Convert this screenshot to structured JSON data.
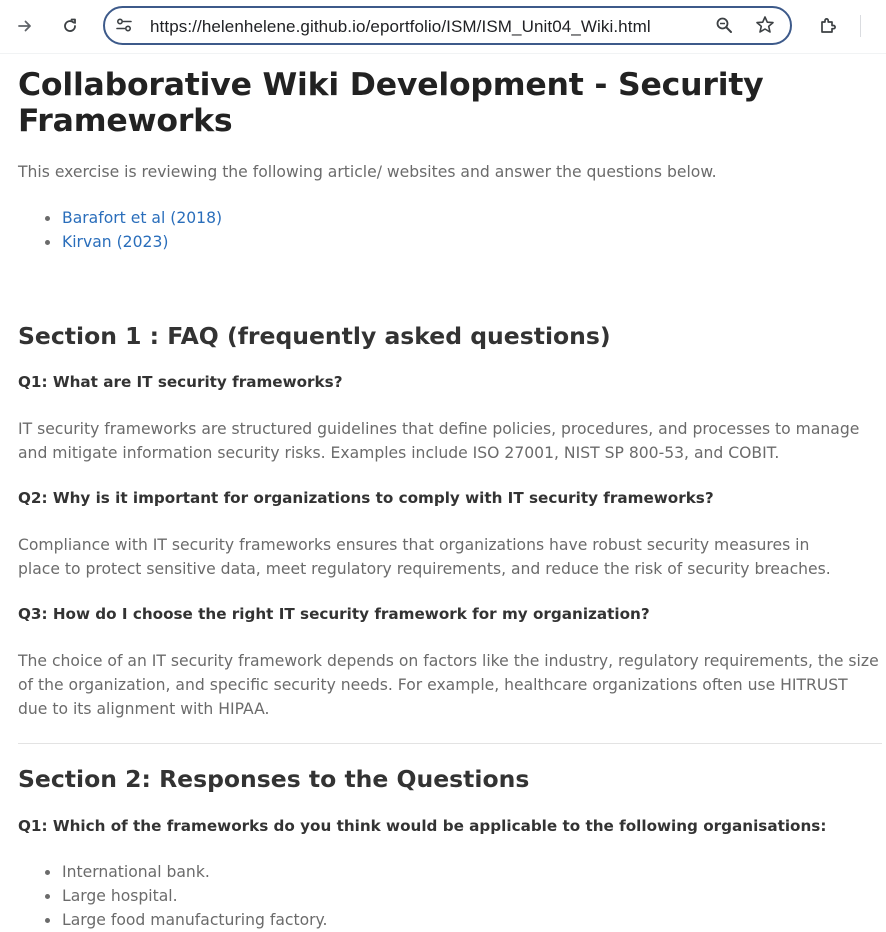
{
  "browser": {
    "url": "https://helenhelene.github.io/eportfolio/ISM/ISM_Unit04_Wiki.html",
    "icons": [
      "forward-arrow-icon",
      "reload-icon",
      "site-settings-icon",
      "zoom-icon",
      "bookmark-star-icon",
      "extensions-icon"
    ]
  },
  "page": {
    "title": "Collaborative Wiki Development - Security Frameworks",
    "intro": "This exercise is reviewing the following article/ websites and answer the questions below.",
    "links": [
      {
        "label": "Barafort et al (2018)"
      },
      {
        "label": "Kirvan (2023)"
      }
    ],
    "section1": {
      "heading": "Section 1 : FAQ (frequently asked questions)",
      "qa": [
        {
          "q": "Q1: What are IT security frameworks?",
          "a": "IT security frameworks are structured guidelines that define policies, procedures, and processes to manage and mitigate information security risks. Examples include ISO 27001, NIST SP 800-53, and COBIT."
        },
        {
          "q": "Q2: Why is it important for organizations to comply with IT security frameworks?",
          "a": "Compliance with IT security frameworks ensures that organizations have robust security measures in place to protect sensitive data, meet regulatory requirements, and reduce the risk of security breaches."
        },
        {
          "q": "Q3: How do I choose the right IT security framework for my organization?",
          "a": "The choice of an IT security framework depends on factors like the industry, regulatory requirements, the size of the organization, and specific security needs. For example, healthcare organizations often use HITRUST due to its alignment with HIPAA."
        }
      ]
    },
    "section2": {
      "heading": "Section 2: Responses to the Questions",
      "q1": "Q1: Which of the frameworks do you think would be applicable to the following organisations:",
      "orgs": [
        "International bank.",
        "Large hospital.",
        "Large food manufacturing factory."
      ]
    }
  },
  "colors": {
    "link": "#2a6ebb",
    "omnibox_border": "#3d5a8a",
    "body_text": "#6b6b6b",
    "heading": "#333333"
  }
}
